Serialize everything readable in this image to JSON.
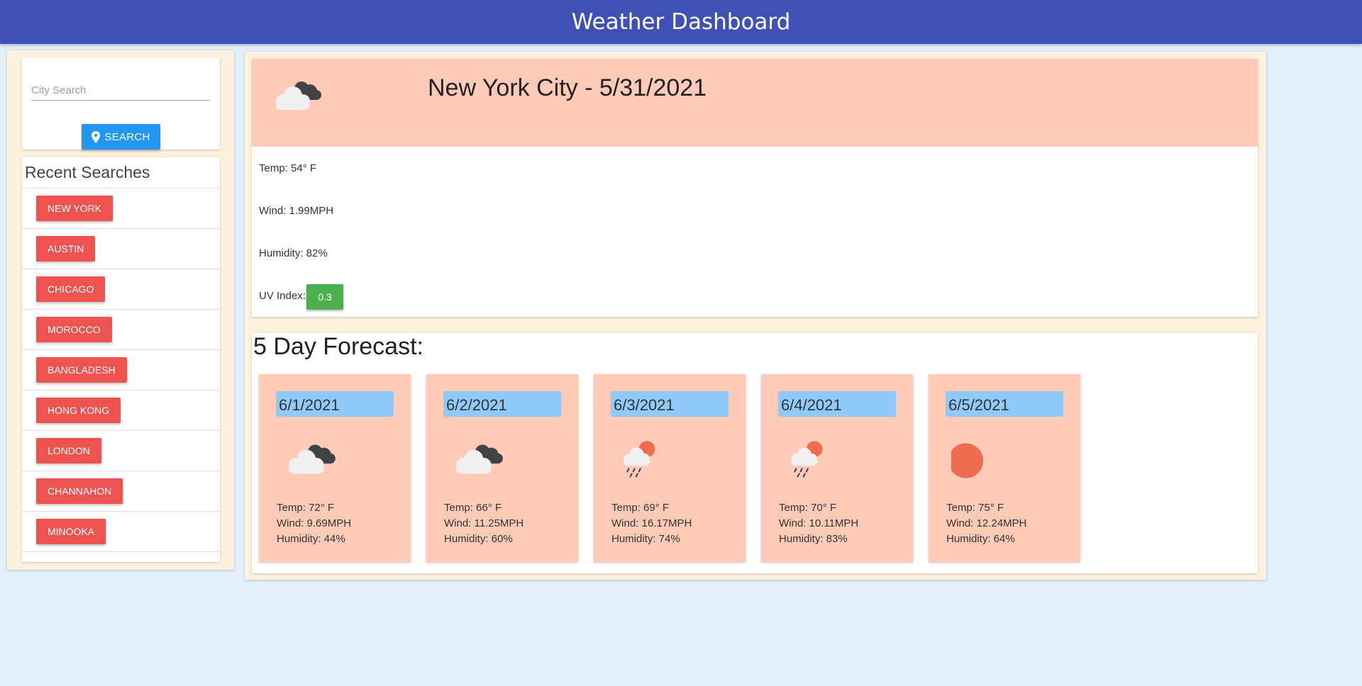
{
  "header": {
    "title": "Weather Dashboard"
  },
  "search": {
    "placeholder": "City Search",
    "value": "",
    "button_label": "SEARCH"
  },
  "recent": {
    "title": "Recent Searches",
    "items": [
      "NEW YORK",
      "AUSTIN",
      "CHICAGO",
      "MOROCCO",
      "BANGLADESH",
      "HONG KONG",
      "LONDON",
      "CHANNAHON",
      "MINOOKA"
    ]
  },
  "current": {
    "title": "New York City - 5/31/2021",
    "icon": "broken-clouds-icon",
    "temp": "Temp: 54° F",
    "wind": "Wind: 1.99MPH",
    "humidity": "Humidity: 82%",
    "uv_label": "UV Index:",
    "uv_value": "0.3",
    "uv_color": "#4caf50"
  },
  "forecast": {
    "title": "5 Day Forecast:",
    "days": [
      {
        "date": "6/1/2021",
        "icon": "broken-clouds-icon",
        "temp": "Temp: 72° F",
        "wind": "Wind: 9.69MPH",
        "humidity": "Humidity: 44%"
      },
      {
        "date": "6/2/2021",
        "icon": "broken-clouds-icon",
        "temp": "Temp: 66° F",
        "wind": "Wind: 11.25MPH",
        "humidity": "Humidity: 60%"
      },
      {
        "date": "6/3/2021",
        "icon": "rain-sun-icon",
        "temp": "Temp: 69° F",
        "wind": "Wind: 16.17MPH",
        "humidity": "Humidity: 74%"
      },
      {
        "date": "6/4/2021",
        "icon": "rain-sun-icon",
        "temp": "Temp: 70° F",
        "wind": "Wind: 10.11MPH",
        "humidity": "Humidity: 83%"
      },
      {
        "date": "6/5/2021",
        "icon": "clear-sun-icon",
        "temp": "Temp: 75° F",
        "wind": "Wind: 12.24MPH",
        "humidity": "Humidity: 64%"
      }
    ]
  },
  "colors": {
    "header": "#3f51b5",
    "page_background": "#e3f0fb",
    "panel_background": "#fdf1de",
    "card_salmon": "#ffcab8",
    "date_blue": "#90caf9",
    "city_button": "#ef5350",
    "search_button": "#2196f3"
  }
}
